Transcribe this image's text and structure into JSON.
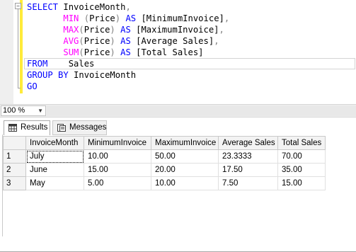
{
  "editor": {
    "collapse_symbol": "−",
    "lines": [
      [
        {
          "t": "SELECT ",
          "c": "kw"
        },
        {
          "t": "InvoiceMonth",
          "c": ""
        },
        {
          "t": ",",
          "c": "gr"
        }
      ],
      [
        {
          "t": "       ",
          "c": ""
        },
        {
          "t": "MIN",
          "c": "fn"
        },
        {
          "t": " (",
          "c": "gr"
        },
        {
          "t": "Price",
          "c": ""
        },
        {
          "t": ")",
          "c": "gr"
        },
        {
          "t": " AS ",
          "c": "kw"
        },
        {
          "t": "[MinimumInvoice]",
          "c": ""
        },
        {
          "t": ",",
          "c": "gr"
        }
      ],
      [
        {
          "t": "       ",
          "c": ""
        },
        {
          "t": "MAX",
          "c": "fn"
        },
        {
          "t": "(",
          "c": "gr"
        },
        {
          "t": "Price",
          "c": ""
        },
        {
          "t": ")",
          "c": "gr"
        },
        {
          "t": " AS ",
          "c": "kw"
        },
        {
          "t": "[MaximumInvoice]",
          "c": ""
        },
        {
          "t": ",",
          "c": "gr"
        }
      ],
      [
        {
          "t": "       ",
          "c": ""
        },
        {
          "t": "AVG",
          "c": "fn"
        },
        {
          "t": "(",
          "c": "gr"
        },
        {
          "t": "Price",
          "c": ""
        },
        {
          "t": ")",
          "c": "gr"
        },
        {
          "t": " AS ",
          "c": "kw"
        },
        {
          "t": "[Average Sales]",
          "c": ""
        },
        {
          "t": ",",
          "c": "gr"
        }
      ],
      [
        {
          "t": "       ",
          "c": ""
        },
        {
          "t": "SUM",
          "c": "fn"
        },
        {
          "t": "(",
          "c": "gr"
        },
        {
          "t": "Price",
          "c": ""
        },
        {
          "t": ")",
          "c": "gr"
        },
        {
          "t": " AS ",
          "c": "kw"
        },
        {
          "t": "[Total Sales]",
          "c": ""
        }
      ],
      [
        {
          "t": "FROM",
          "c": "kw"
        },
        {
          "t": "    Sales",
          "c": ""
        }
      ],
      [
        {
          "t": "GROUP BY ",
          "c": "kw"
        },
        {
          "t": "InvoiceMonth",
          "c": ""
        }
      ],
      [
        {
          "t": "GO",
          "c": "kw"
        }
      ]
    ]
  },
  "zoom": {
    "value": "100 %",
    "arrow": "▼"
  },
  "tabs": {
    "results": "Results",
    "messages": "Messages"
  },
  "grid": {
    "columns": [
      "InvoiceMonth",
      "MinimumInvoice",
      "MaximumInvoice",
      "Average Sales",
      "Total Sales"
    ],
    "rows": [
      {
        "n": "1",
        "cells": [
          "July",
          "10.00",
          "50.00",
          "23.3333",
          "70.00"
        ]
      },
      {
        "n": "2",
        "cells": [
          "June",
          "15.00",
          "20.00",
          "17.50",
          "35.00"
        ]
      },
      {
        "n": "3",
        "cells": [
          "May",
          "5.00",
          "10.00",
          "7.50",
          "15.00"
        ]
      }
    ]
  },
  "colors": {
    "keyword": "#0000ff",
    "function": "#ff00ff",
    "operator": "#808080",
    "change_bar": "#ffeb3b"
  }
}
